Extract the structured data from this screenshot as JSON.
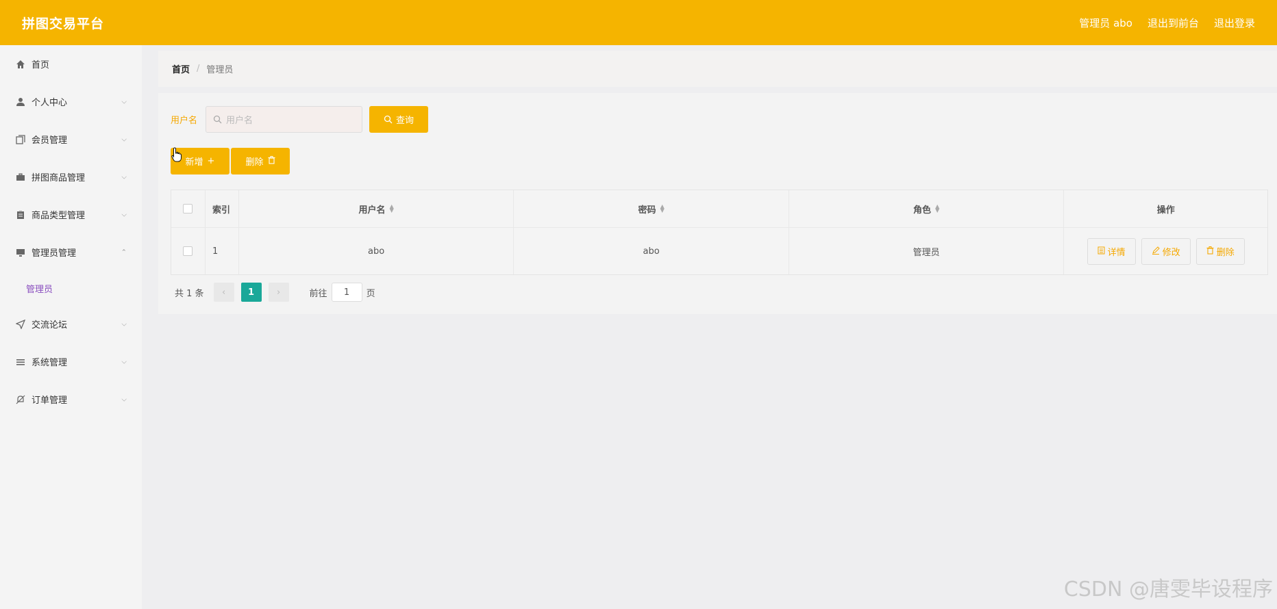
{
  "header": {
    "title": "拼图交易平台",
    "user_label": "管理员 abo",
    "back_front": "退出到前台",
    "logout": "退出登录"
  },
  "sidebar": {
    "items": [
      {
        "label": "首页",
        "icon": "home-icon",
        "chevron": ""
      },
      {
        "label": "个人中心",
        "icon": "user-icon",
        "chevron": "⌵"
      },
      {
        "label": "会员管理",
        "icon": "copy-icon",
        "chevron": "⌵"
      },
      {
        "label": "拼图商品管理",
        "icon": "briefcase-icon",
        "chevron": "⌵"
      },
      {
        "label": "商品类型管理",
        "icon": "clipboard-icon",
        "chevron": "⌵"
      },
      {
        "label": "管理员管理",
        "icon": "monitor-icon",
        "chevron": "⌃"
      },
      {
        "label": "交流论坛",
        "icon": "send-icon",
        "chevron": "⌵"
      },
      {
        "label": "系统管理",
        "icon": "menu-icon",
        "chevron": "⌵"
      },
      {
        "label": "订单管理",
        "icon": "bell-off-icon",
        "chevron": "⌵"
      }
    ],
    "submenu_active": "管理员"
  },
  "breadcrumb": {
    "home": "首页",
    "separator": "/",
    "current": "管理员"
  },
  "search": {
    "label": "用户名",
    "placeholder": "用户名",
    "button": "查询"
  },
  "actions": {
    "add": "新增",
    "delete": "删除"
  },
  "table": {
    "columns": [
      "索引",
      "用户名",
      "密码",
      "角色",
      "操作"
    ],
    "rows": [
      {
        "index": "1",
        "username": "abo",
        "password": "abo",
        "role": "管理员"
      }
    ],
    "ops": {
      "detail": "详情",
      "edit": "修改",
      "delete": "删除"
    }
  },
  "pagination": {
    "total": "共 1 条",
    "current_page": "1",
    "goto_label": "前往",
    "goto_value": "1",
    "page_suffix": "页"
  },
  "watermark": "CSDN @唐雯毕设程序",
  "colors": {
    "primary": "#f5b400",
    "pager_active": "#1aa899",
    "submenu_active": "#8a4fbf"
  }
}
